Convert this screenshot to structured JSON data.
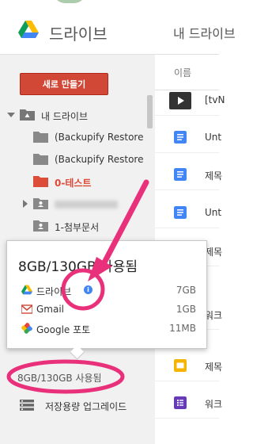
{
  "header": {
    "app_name": "드라이브",
    "current_location": "내 드라이브"
  },
  "sidebar": {
    "new_button_label": "새로 만들기",
    "root_label": "내 드라이브",
    "folders": [
      {
        "label": "(Backupify Restore"
      },
      {
        "label": "(Backupify Restore"
      },
      {
        "label": "0-테스트"
      },
      {
        "label": ""
      },
      {
        "label": "1-첨부문서"
      }
    ],
    "storage_summary": "8GB/130GB 사용됨",
    "upgrade_label": "저장용량 업그레이드"
  },
  "file_list": {
    "column_header": "이름",
    "rows": [
      {
        "name": "[tvN",
        "icon": "video-thumbnail"
      },
      {
        "name": "Unt",
        "icon": "docs-icon"
      },
      {
        "name": "제목",
        "icon": "docs-icon"
      },
      {
        "name": "Unt",
        "icon": "docs-icon"
      },
      {
        "name": "제목",
        "icon": "docs-icon"
      },
      {
        "name": "워크",
        "icon": "docs-icon"
      },
      {
        "name": "제목",
        "icon": "slides-icon"
      },
      {
        "name": "워크",
        "icon": "forms-icon"
      }
    ]
  },
  "storage_popup": {
    "total": "8GB/130GB 사용됨",
    "items": [
      {
        "name": "드라이브",
        "value": "7GB",
        "icon": "drive-icon"
      },
      {
        "name": "Gmail",
        "value": "1GB",
        "icon": "gmail-icon"
      },
      {
        "name": "Google 포토",
        "value": "11MB",
        "icon": "photos-icon"
      }
    ]
  },
  "colors": {
    "new_button": "#d14836",
    "annotation": "#e8317a",
    "docs_blue": "#4285f4",
    "slides_yellow": "#f4b400",
    "forms_purple": "#673ab7"
  }
}
